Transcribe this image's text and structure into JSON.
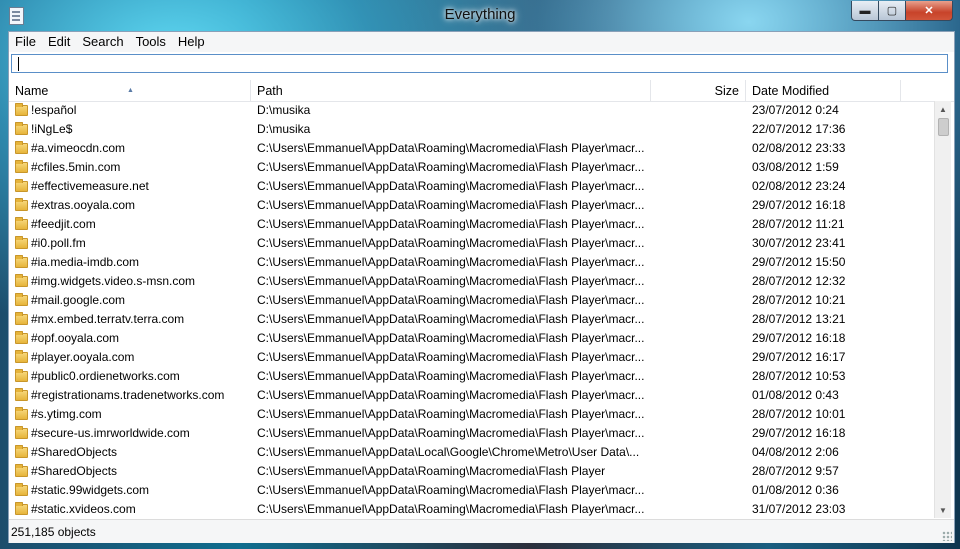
{
  "window": {
    "title": "Everything",
    "minimize_glyph": "▬",
    "maximize_glyph": "▢",
    "close_glyph": "✕"
  },
  "menu": [
    "File",
    "Edit",
    "Search",
    "Tools",
    "Help"
  ],
  "search": {
    "value": "",
    "placeholder": ""
  },
  "columns": {
    "name": "Name",
    "path": "Path",
    "size": "Size",
    "date": "Date Modified"
  },
  "rows": [
    {
      "name": "!español",
      "path": "D:\\musika",
      "date": "23/07/2012 0:24"
    },
    {
      "name": "!iNgLe$",
      "path": "D:\\musika",
      "date": "22/07/2012 17:36"
    },
    {
      "name": "#a.vimeocdn.com",
      "path": "C:\\Users\\Emmanuel\\AppData\\Roaming\\Macromedia\\Flash Player\\macr...",
      "date": "02/08/2012 23:33"
    },
    {
      "name": "#cfiles.5min.com",
      "path": "C:\\Users\\Emmanuel\\AppData\\Roaming\\Macromedia\\Flash Player\\macr...",
      "date": "03/08/2012 1:59"
    },
    {
      "name": "#effectivemeasure.net",
      "path": "C:\\Users\\Emmanuel\\AppData\\Roaming\\Macromedia\\Flash Player\\macr...",
      "date": "02/08/2012 23:24"
    },
    {
      "name": "#extras.ooyala.com",
      "path": "C:\\Users\\Emmanuel\\AppData\\Roaming\\Macromedia\\Flash Player\\macr...",
      "date": "29/07/2012 16:18"
    },
    {
      "name": "#feedjit.com",
      "path": "C:\\Users\\Emmanuel\\AppData\\Roaming\\Macromedia\\Flash Player\\macr...",
      "date": "28/07/2012 11:21"
    },
    {
      "name": "#i0.poll.fm",
      "path": "C:\\Users\\Emmanuel\\AppData\\Roaming\\Macromedia\\Flash Player\\macr...",
      "date": "30/07/2012 23:41"
    },
    {
      "name": "#ia.media-imdb.com",
      "path": "C:\\Users\\Emmanuel\\AppData\\Roaming\\Macromedia\\Flash Player\\macr...",
      "date": "29/07/2012 15:50"
    },
    {
      "name": "#img.widgets.video.s-msn.com",
      "path": "C:\\Users\\Emmanuel\\AppData\\Roaming\\Macromedia\\Flash Player\\macr...",
      "date": "28/07/2012 12:32"
    },
    {
      "name": "#mail.google.com",
      "path": "C:\\Users\\Emmanuel\\AppData\\Roaming\\Macromedia\\Flash Player\\macr...",
      "date": "28/07/2012 10:21"
    },
    {
      "name": "#mx.embed.terratv.terra.com",
      "path": "C:\\Users\\Emmanuel\\AppData\\Roaming\\Macromedia\\Flash Player\\macr...",
      "date": "28/07/2012 13:21"
    },
    {
      "name": "#opf.ooyala.com",
      "path": "C:\\Users\\Emmanuel\\AppData\\Roaming\\Macromedia\\Flash Player\\macr...",
      "date": "29/07/2012 16:18"
    },
    {
      "name": "#player.ooyala.com",
      "path": "C:\\Users\\Emmanuel\\AppData\\Roaming\\Macromedia\\Flash Player\\macr...",
      "date": "29/07/2012 16:17"
    },
    {
      "name": "#public0.ordienetworks.com",
      "path": "C:\\Users\\Emmanuel\\AppData\\Roaming\\Macromedia\\Flash Player\\macr...",
      "date": "28/07/2012 10:53"
    },
    {
      "name": "#registrationams.tradenetworks.com",
      "path": "C:\\Users\\Emmanuel\\AppData\\Roaming\\Macromedia\\Flash Player\\macr...",
      "date": "01/08/2012 0:43"
    },
    {
      "name": "#s.ytimg.com",
      "path": "C:\\Users\\Emmanuel\\AppData\\Roaming\\Macromedia\\Flash Player\\macr...",
      "date": "28/07/2012 10:01"
    },
    {
      "name": "#secure-us.imrworldwide.com",
      "path": "C:\\Users\\Emmanuel\\AppData\\Roaming\\Macromedia\\Flash Player\\macr...",
      "date": "29/07/2012 16:18"
    },
    {
      "name": "#SharedObjects",
      "path": "C:\\Users\\Emmanuel\\AppData\\Local\\Google\\Chrome\\Metro\\User Data\\...",
      "date": "04/08/2012 2:06"
    },
    {
      "name": "#SharedObjects",
      "path": "C:\\Users\\Emmanuel\\AppData\\Roaming\\Macromedia\\Flash Player",
      "date": "28/07/2012 9:57"
    },
    {
      "name": "#static.99widgets.com",
      "path": "C:\\Users\\Emmanuel\\AppData\\Roaming\\Macromedia\\Flash Player\\macr...",
      "date": "01/08/2012 0:36"
    },
    {
      "name": "#static.xvideos.com",
      "path": "C:\\Users\\Emmanuel\\AppData\\Roaming\\Macromedia\\Flash Player\\macr...",
      "date": "31/07/2012 23:03"
    }
  ],
  "status": {
    "text": "251,185 objects"
  },
  "icons": {
    "row_icon": "folder-icon",
    "app_icon": "document-icon"
  },
  "colors": {
    "folder": "#e6b43a",
    "search_border": "#5a8fc8",
    "close_button": "#c7432a"
  }
}
